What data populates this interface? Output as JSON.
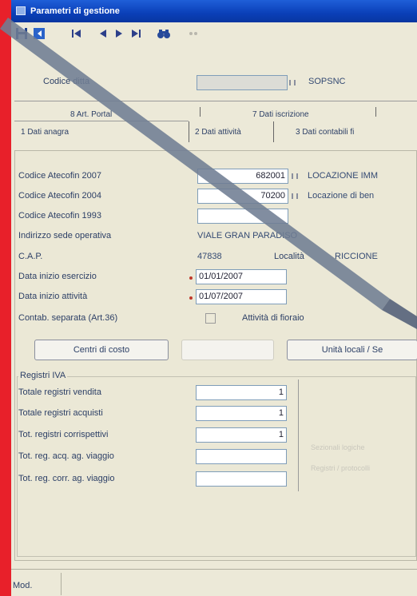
{
  "window": {
    "title": "Parametri di gestione"
  },
  "toolbar": {
    "icons": [
      "save-icon",
      "exit-icon",
      "first-record-icon",
      "previous-record-icon",
      "next-record-icon",
      "last-record-icon",
      "binoculars-icon",
      "disabled-icon"
    ]
  },
  "header": {
    "codice_ditta_label": "Codice ditta",
    "codice_ditta_value": "",
    "ditta_name": "SOPSNC"
  },
  "tabs": {
    "row1": [
      "8 Art. Portal",
      "7 Dati iscrizione"
    ],
    "row2": [
      "1 Dati anagra",
      "2 Dati attività",
      "3 Dati contabili fi"
    ]
  },
  "attivita": {
    "ateco2007_label": "Codice Atecofin 2007",
    "ateco2007_value": "682001",
    "ateco2007_desc": "LOCAZIONE IMM",
    "ateco2004_label": "Codice Atecofin 2004",
    "ateco2004_value": "70200",
    "ateco2004_desc": "Locazione di ben",
    "ateco1993_label": "Codice Atecofin 1993",
    "ateco1993_value": "",
    "indirizzo_label": "Indirizzo sede operativa",
    "indirizzo_value": "VIALE GRAN PARADISO",
    "cap_label": "C.A.P.",
    "cap_value": "47838",
    "localita_label": "Località",
    "localita_value": "RICCIONE",
    "inizio_esercizio_label": "Data inizio esercizio",
    "inizio_esercizio_value": "01/01/2007",
    "inizio_attivita_label": "Data inizio attività",
    "inizio_attivita_value": "01/07/2007",
    "contab_separata_label": "Contab. separata (Art.36)",
    "fioraio_label": "Attività di fioraio"
  },
  "buttons": {
    "centri_costo": "Centri di costo",
    "disabled_button": "",
    "unita_locali": "Unità locali / Se"
  },
  "registri": {
    "group_label": "Registri IVA",
    "rows": [
      {
        "label": "Totale registri vendita",
        "value": "1"
      },
      {
        "label": "Totale registri acquisti",
        "value": "1"
      },
      {
        "label": "Tot. registri corrispettivi",
        "value": "1"
      },
      {
        "label": "Tot. reg. acq. ag. viaggio",
        "value": ""
      },
      {
        "label": "Tot. reg. corr. ag. viaggio",
        "value": ""
      }
    ],
    "faint_text_1": "Sezionali logiche",
    "faint_text_2": "Registri / protocolli"
  },
  "statusbar": {
    "mode": "Mod."
  },
  "colors": {
    "titlebar": "#0a3fb8",
    "background_red": "#e8202a",
    "window": "#ece9d8"
  }
}
